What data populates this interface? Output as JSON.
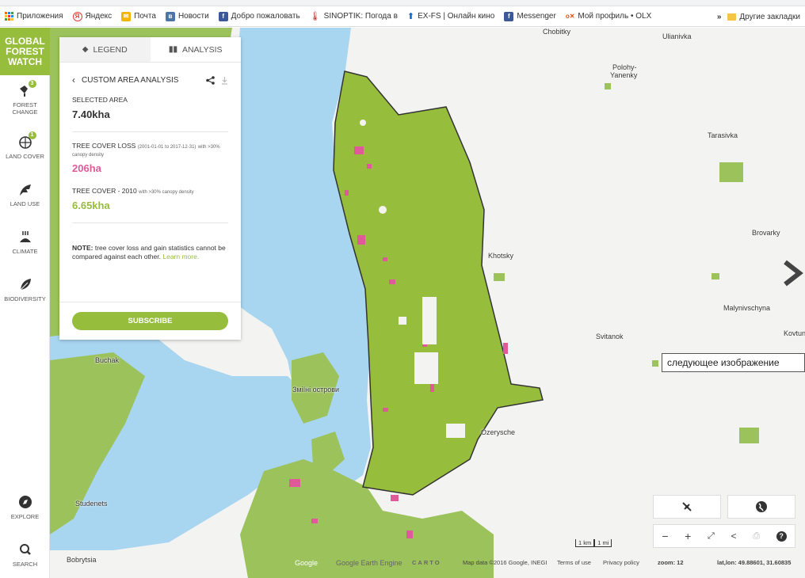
{
  "browser": {
    "bookmarks": [
      {
        "label": "Приложения",
        "icon": "apps-grid-icon",
        "color": "#e8710a"
      },
      {
        "label": "Яндекс",
        "icon": "yandex-icon",
        "color": "#e53935"
      },
      {
        "label": "Почта",
        "icon": "mail-icon",
        "color": "#f4b400"
      },
      {
        "label": "Новости",
        "icon": "vk-icon",
        "color": "#4a76a8"
      },
      {
        "label": "Добро пожаловать",
        "icon": "facebook-icon",
        "color": "#3b5998"
      },
      {
        "label": "SINOPTIK: Погода в",
        "icon": "thermometer-icon",
        "color": "#c62828"
      },
      {
        "label": "EX-FS | Онлайн кино",
        "icon": "arrow-up-icon",
        "color": "#1565c0"
      },
      {
        "label": "Messenger",
        "icon": "facebook-icon",
        "color": "#3b5998"
      },
      {
        "label": "Мой профиль • OLX",
        "icon": "olx-icon",
        "color": "#e65100"
      }
    ],
    "more": "»",
    "other_bookmarks": "Другие закладки"
  },
  "sidebar": {
    "logo": [
      "GLOBAL",
      "FOREST",
      "WATCH"
    ],
    "items": [
      {
        "label": "FOREST CHANGE",
        "icon": "forest-change-icon",
        "badge": "3"
      },
      {
        "label": "LAND COVER",
        "icon": "globe-tree-icon",
        "badge": "1"
      },
      {
        "label": "LAND USE",
        "icon": "land-use-icon"
      },
      {
        "label": "CLIMATE",
        "icon": "climate-icon"
      },
      {
        "label": "BIODIVERSITY",
        "icon": "leaf-icon"
      }
    ],
    "bottom": [
      {
        "label": "EXPLORE",
        "icon": "compass-icon"
      },
      {
        "label": "SEARCH",
        "icon": "search-icon"
      }
    ]
  },
  "panel": {
    "tabs": [
      {
        "label": "LEGEND",
        "icon": "layers-icon"
      },
      {
        "label": "ANALYSIS",
        "icon": "bar-chart-icon"
      }
    ],
    "title": "CUSTOM AREA ANALYSIS",
    "selected_label": "SELECTED AREA",
    "selected_value": "7.40kha",
    "loss_label": "TREE COVER LOSS",
    "loss_note": "(2001-01-01 to 2017-12-31)",
    "loss_note2": "with >30%",
    "loss_note3": "canopy density",
    "loss_value": "206ha",
    "cover_label": "TREE COVER - 2010",
    "cover_note": "with >30% canopy density",
    "cover_value": "6.65kha",
    "note_bold": "NOTE:",
    "note_text": "tree cover loss and gain statistics cannot be compared against each other.",
    "note_link": "Learn more.",
    "subscribe": "SUBSCRIBE",
    "colors": {
      "loss": "#e05a9a",
      "cover": "#97bd3d"
    }
  },
  "map": {
    "places": [
      "Chobitky",
      "Ulianivka",
      "Polohy-",
      "Yanenky",
      "Tarasivka",
      "Brovarky",
      "Khotsky",
      "Malynivschyna",
      "Svitanok",
      "Kovtun",
      "Buchak",
      "Зміїні острови",
      "Ozerysche",
      "Studenets",
      "Bobrytsia"
    ],
    "next_tooltip": "следующее изображение",
    "scale": [
      "1 km",
      "1 mi"
    ],
    "attribution": {
      "google": "Google",
      "earth_engine": "Google Earth Engine",
      "carto": "CARTO",
      "map_data": "Map data ©2016 Google, INEGI",
      "terms": "Terms of use",
      "privacy": "Privacy policy",
      "zoom": "zoom: 12",
      "latlon": "lat,lon: 49.88601, 31.60835"
    }
  }
}
